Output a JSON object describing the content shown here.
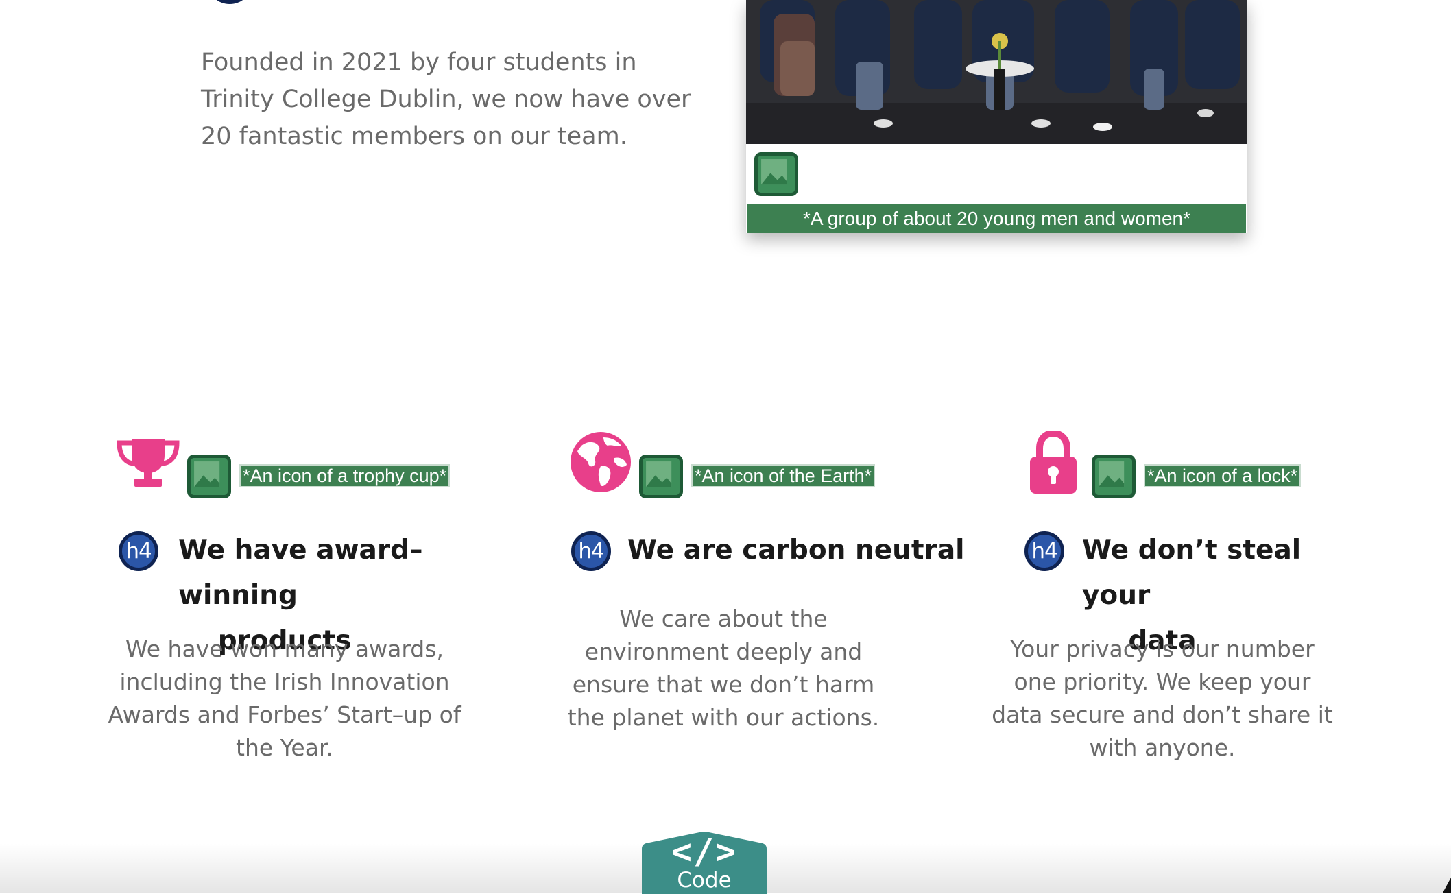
{
  "about": {
    "intro": "Founded in 2021 by four students in Trinity College Dublin, we now have over 20 fantastic members on our team.",
    "photo_alt": "*A group of about 20 young men and women*"
  },
  "features": [
    {
      "icon": "trophy-icon",
      "icon_alt": "*An icon of a trophy cup*",
      "badge": "h4",
      "title_line1": "We have award–winning",
      "title_line2": "products",
      "text": "We have won many awards, including the Irish Innovation Awards and Forbes’ Start–up of the Year."
    },
    {
      "icon": "earth-icon",
      "icon_alt": "*An icon of the Earth*",
      "badge": "h4",
      "title_line1": "We are carbon neutral",
      "title_line2": "",
      "text": "We care about the environment deeply and ensure that we don’t harm the planet with our actions."
    },
    {
      "icon": "lock-icon",
      "icon_alt": "*An icon of a lock*",
      "badge": "h4",
      "title_line1": "We don’t steal your",
      "title_line2": "data",
      "text": "Your privacy is our number one priority. We keep your data secure and don’t share it with anyone."
    }
  ],
  "code_tab": {
    "label": "Code",
    "symbol": "</>"
  },
  "colors": {
    "accent_pink": "#e83f8a",
    "badge_blue": "#2b56a8",
    "alt_green": "#3d8051",
    "code_teal": "#3c8e88"
  }
}
